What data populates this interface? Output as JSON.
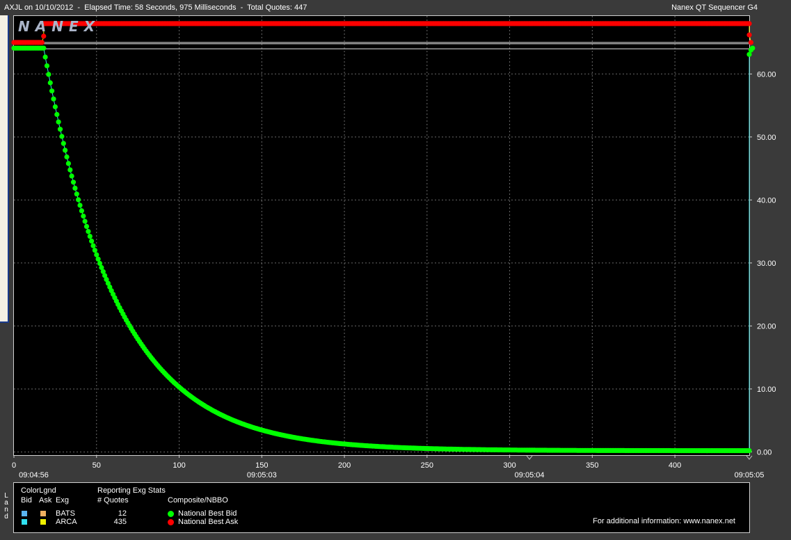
{
  "header": {
    "title": "AXJL on 10/10/2012  -  Elapsed Time: 58 Seconds, 975 Milliseconds  -  Total Quotes: 447",
    "app_name": "Nanex QT Sequencer G4",
    "logo": "NANEX"
  },
  "chart_data": {
    "type": "scatter",
    "title": "",
    "xlabel": "",
    "ylabel": "",
    "xlim": [
      0,
      445
    ],
    "ylim": [
      -0.5,
      69.2
    ],
    "x_ticks": [
      0,
      50,
      100,
      150,
      200,
      250,
      300,
      350,
      400
    ],
    "y_ticks": [
      0,
      10,
      20,
      30,
      40,
      50,
      60
    ],
    "y_tick_labels": [
      "0.00",
      "10.00",
      "20.00",
      "30.00",
      "40.00",
      "50.00",
      "60.00"
    ],
    "time_labels": [
      {
        "x": 12,
        "label": "09:04:56"
      },
      {
        "x": 150,
        "label": "09:05:03"
      },
      {
        "x": 312,
        "label": "09:05:04"
      },
      {
        "x": 445,
        "label": "09:05:05"
      }
    ],
    "grid": true,
    "reference_lines": [
      64.0,
      64.8,
      65.0
    ],
    "series": [
      {
        "name": "National Best Bid",
        "color": "#00ff00",
        "segments": [
          {
            "x": [
              0,
              17
            ],
            "y": [
              64.1,
              64.1
            ]
          },
          {
            "x": [
              18,
              445
            ],
            "y": [
              64.1,
              0.2
            ],
            "shape": "exponential-decay",
            "decay_rate": 0.0225
          }
        ],
        "recovery": [
          {
            "x": 445,
            "y": 63.1
          },
          {
            "x": 446,
            "y": 63.8
          },
          {
            "x": 447,
            "y": 64.1
          }
        ]
      },
      {
        "name": "National Best Ask",
        "color": "#ff0000",
        "segments": [
          {
            "x": [
              0,
              17
            ],
            "y": [
              65.0,
              65.0
            ]
          },
          {
            "x": [
              18,
              445
            ],
            "y": [
              68.0,
              68.0
            ]
          }
        ],
        "transitions": [
          {
            "x": 18,
            "y": 66.0
          },
          {
            "x": 445,
            "y": 66.2
          },
          {
            "x": 446,
            "y": 65.0
          }
        ]
      }
    ],
    "lines": [
      {
        "name": "BATS",
        "color": "#3ea6ff"
      },
      {
        "name": "ARCA",
        "color": "#40e0e0"
      }
    ]
  },
  "legend": {
    "side_label": "Land",
    "color_legend_title": "ColorLgnd",
    "col_bid": "Bid",
    "col_ask": "Ask",
    "col_exg": "Exg",
    "stats_title": "Reporting Exg Stats",
    "stats_col": "# Quotes",
    "composite_title": "Composite/NBBO",
    "exchanges": [
      {
        "name": "BATS",
        "quotes": "12",
        "bid_color": "#5ab4f0",
        "ask_color": "#f0b060"
      },
      {
        "name": "ARCA",
        "quotes": "435",
        "bid_color": "#30e0f0",
        "ask_color": "#f0f000"
      }
    ],
    "nbbo": [
      {
        "label": "National Best Bid",
        "color": "#00ff00"
      },
      {
        "label": "National Best Ask",
        "color": "#ff0000"
      }
    ],
    "footer": "For additional information: www.nanex.net"
  }
}
